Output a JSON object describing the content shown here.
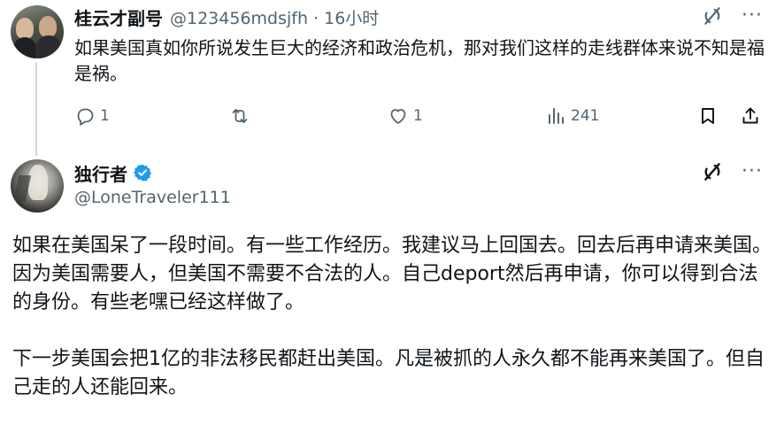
{
  "reply_tweet": {
    "author_name": "桂云才副号",
    "handle_time": "@123456mdsjfh · 16小时",
    "text": "如果美国真如你所说发生巨大的经济和政治危机，那对我们这样的走线群体来说不知是福是祸。",
    "actions": {
      "reply_count": "1",
      "retweet_count": "",
      "like_count": "1",
      "views_count": "241"
    }
  },
  "main_tweet": {
    "author_name": "独行者",
    "handle": "@LoneTraveler111",
    "verified": true,
    "paragraph1": "如果在美国呆了一段时间。有一些工作经历。我建议马上回国去。回去后再申请来美国。因为美国需要人，但美国不需要不合法的人。自己deport然后再申请，你可以得到合法的身份。有些老嘿已经这样做了。",
    "paragraph2": "下一步美国会把1亿的非法移民都赶出美国。凡是被抓的人永久都不能再来美国了。但自己走的人还能回来。"
  },
  "icons": {
    "grok": "grok-icon",
    "more": "more-icon",
    "reply": "reply-icon",
    "retweet": "retweet-icon",
    "like": "like-icon",
    "views": "views-icon",
    "bookmark": "bookmark-icon",
    "share": "share-icon",
    "verified": "verified-badge-icon"
  },
  "colors": {
    "text": "#0f1419",
    "secondary": "#536471",
    "verified_blue": "#1d9bf0",
    "thread_line": "#cfd9de"
  },
  "more_label": "···"
}
